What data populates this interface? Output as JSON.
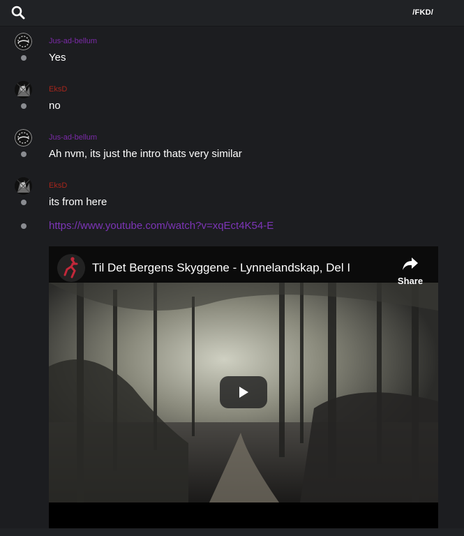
{
  "header": {
    "search_icon": "search-icon",
    "channel": "/FKD/"
  },
  "messages": [
    {
      "author": "Jus-ad-bellum",
      "author_color": "#7b2aa8",
      "text": "Yes"
    },
    {
      "author": "EksD",
      "author_color": "#a6261c",
      "text": "no"
    },
    {
      "author": "Jus-ad-bellum",
      "author_color": "#7b2aa8",
      "text": "Ah nvm, its just the intro thats very similar"
    },
    {
      "author": "EksD",
      "author_color": "#a6261c",
      "text": "its from here"
    }
  ],
  "link": {
    "url": "https://www.youtube.com/watch?v=xqEct4K54-E"
  },
  "embed": {
    "title": "Til Det Bergens Skyggene - Lynnelandskap, Del I",
    "share_label": "Share",
    "play_icon": "play-icon",
    "share_icon": "share-icon"
  },
  "colors": {
    "background": "#1c1d20",
    "link": "#7d35b8"
  }
}
